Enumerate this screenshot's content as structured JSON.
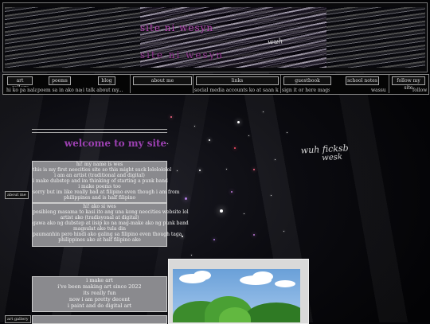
{
  "header": {
    "title_top": "site ni wesyn",
    "title_bottom": "site ni wesyn",
    "scribble": "wuh"
  },
  "nav": {
    "items": [
      {
        "label": "art gallery",
        "desc": "hi ko pa nalal..."
      },
      {
        "label": "poems",
        "desc": "poem sa in ako nagsusulat"
      },
      {
        "label": "blog",
        "desc": "i talk about my..."
      },
      {
        "label": "about me",
        "desc": ""
      },
      {
        "label": "links",
        "desc": "social media accounts ko at saan ko nagpo-post"
      },
      {
        "label": "guestbook",
        "desc": "sign it or here magsuli"
      },
      {
        "label": "school notes",
        "desc": "wassu i"
      },
      {
        "label": "follow my site",
        "desc": "follow"
      }
    ]
  },
  "welcome": {
    "title": "welcome to my site",
    "english_lines": [
      "hi! my name is wes",
      "this is my first neocities site so this might suck lololololol",
      "i am an artist (traditional and digital)",
      "i make dubstep and im thinking of starting a punk band",
      "i make poems too",
      "sorry but im like really bad at filipino even though i am from",
      "philippines and is half filipino"
    ],
    "filipino_lines": [
      "hi! ako si wes",
      "posibleng masama to kasi ito ang una kong neocities website lol",
      "artist ako (tradisyonal at digital)",
      "gawa ako ng dubstep at iisip ko na mag-make ako ng punk band",
      "magsulat ako tula din",
      "paumanhin pero hindi ako galing sa filipino even though taga",
      "philippines ako at half filipino ako"
    ]
  },
  "side_buttons": {
    "about_me": "about me",
    "art_gallery": "art gallery"
  },
  "art_box": {
    "lines": [
      "i make art",
      "i've been making art since 2022",
      "its really fun",
      "now i am pretty decent",
      "i paint and do digital art"
    ]
  },
  "handwriting": {
    "line1": "wuh ficksb",
    "line2": "wesk"
  }
}
